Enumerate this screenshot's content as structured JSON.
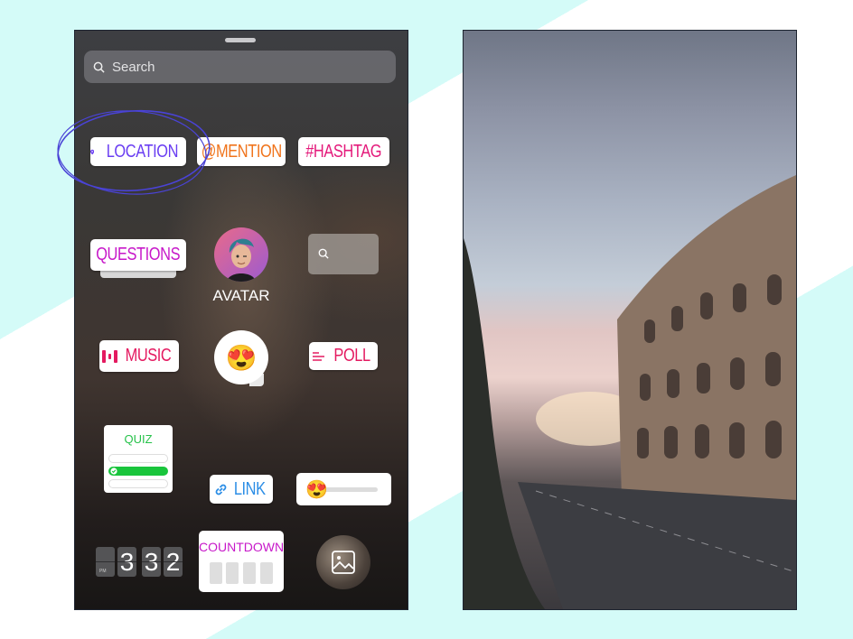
{
  "tray": {
    "search": {
      "placeholder": "Search",
      "value": ""
    },
    "stickers": {
      "location": "LOCATION",
      "mention": "@MENTION",
      "hashtag": "#HASHTAG",
      "questions": "QUESTIONS",
      "avatar": "AVATAR",
      "music": "MUSIC",
      "emoji": "😍",
      "poll": "POLL",
      "quiz": "QUIZ",
      "link": "LINK",
      "slider_emoji": "😍",
      "clock": {
        "digits": [
          "3",
          "3",
          "2"
        ],
        "meridiem": "PM"
      },
      "countdown": "COUNTDOWN"
    }
  },
  "annotation": {
    "highlighted": "location",
    "color": "#4a43d6"
  },
  "colors": {
    "location": "#6a3ef2",
    "mention": "#f0741c",
    "hashtag": "#e41a7b",
    "questions": "#c718c9",
    "music": "#e41a60",
    "poll": "#e41a60",
    "quiz": "#26c24a",
    "link": "#2c8ee6",
    "countdown": "#c718c9",
    "background": "#d4fbf8"
  },
  "preview": {
    "scene": "Colosseum at sunset"
  }
}
